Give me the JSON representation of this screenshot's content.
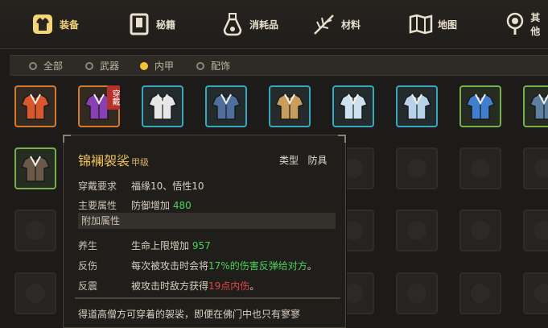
{
  "tabs": [
    {
      "label": "装备",
      "icon": "armor-icon",
      "active": true
    },
    {
      "label": "秘籍",
      "icon": "book-icon"
    },
    {
      "label": "消耗品",
      "icon": "potion-icon"
    },
    {
      "label": "材料",
      "icon": "herb-icon"
    },
    {
      "label": "地图",
      "icon": "map-icon"
    },
    {
      "label": "其他",
      "icon": "mirror-icon"
    }
  ],
  "filters": [
    {
      "label": "全部",
      "selected": false
    },
    {
      "label": "武器",
      "selected": false
    },
    {
      "label": "内甲",
      "selected": true
    },
    {
      "label": "配饰",
      "selected": false
    }
  ],
  "inventory": {
    "equipped_badge": "穿戴",
    "items_row1": [
      {
        "name": "orange-robe",
        "rarity": "orange",
        "color": "#d9572d"
      },
      {
        "name": "purple-robe",
        "rarity": "orange",
        "color": "#8a3fb5",
        "equipped": true
      },
      {
        "name": "white-robe",
        "rarity": "teal",
        "color": "#e6e6e6"
      },
      {
        "name": "navy-robe",
        "rarity": "teal",
        "color": "#4e6f9e"
      },
      {
        "name": "tan-robe",
        "rarity": "teal",
        "color": "#c99d5e"
      },
      {
        "name": "blue-white-robe",
        "rarity": "teal",
        "color": "#cfe1f0"
      },
      {
        "name": "light-blue-robe",
        "rarity": "teal",
        "color": "#b8d2ea"
      },
      {
        "name": "blue-robe",
        "rarity": "green",
        "color": "#3f7fd0"
      },
      {
        "name": "gray-robe",
        "rarity": "green",
        "color": "#5d7fa0"
      }
    ],
    "items_row2": [
      {
        "name": "brown-robe",
        "rarity": "green",
        "color": "#6a5848"
      }
    ]
  },
  "tooltip": {
    "name": "锦襕袈裟",
    "grade": "甲级",
    "type_label": "类型",
    "type_value": "防具",
    "req_label": "穿戴要求",
    "req_value": "福缘10、悟性10",
    "main_label": "主要属性",
    "main_text": "防御增加",
    "main_value": "480",
    "extra_header": "附加属性",
    "attrs": [
      {
        "key": "养生",
        "pre": "生命上限增加",
        "hl": "957",
        "post": "",
        "hl_color": "green"
      },
      {
        "key": "反伤",
        "pre": "每次被攻击时会将",
        "hl": "17%的伤害反弹给对方",
        "post": "。",
        "hl_color": "green"
      },
      {
        "key": "反震",
        "pre": "被攻击时敌方获得",
        "hl": "19点内伤",
        "post": "。",
        "hl_color": "red"
      }
    ],
    "description": "得道高僧方可穿着的袈裟，即便在佛门中也只有寥寥"
  },
  "colors": {
    "accent": "#f3c431",
    "rarity_orange": "#d57a2c",
    "rarity_teal": "#3aa6bd",
    "rarity_green": "#76b04a"
  }
}
